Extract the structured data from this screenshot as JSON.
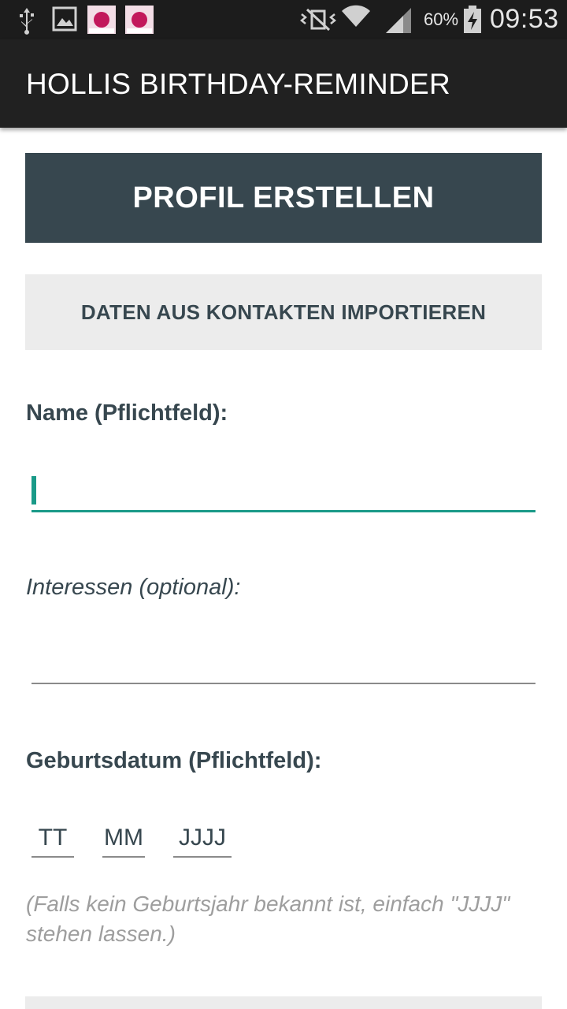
{
  "status_bar": {
    "icons": [
      "usb-icon",
      "image-icon",
      "hollis-reminder-app-icon",
      "hollis-reminder-app-icon",
      "vibrate-icon",
      "wifi-icon",
      "signal-icon",
      "battery-charging-icon"
    ],
    "battery_percent": "60%",
    "time": "09:53"
  },
  "app_bar": {
    "title": "HOLLIS BIRTHDAY-REMINDER"
  },
  "header": {
    "title": "PROFIL ERSTELLEN"
  },
  "import_button": {
    "label": "DATEN AUS KONTAKTEN IMPORTIEREN"
  },
  "form": {
    "name_label": "Name (Pflichtfeld):",
    "name_value": "",
    "interests_label": "Interessen (optional):",
    "interests_value": "",
    "birthdate_label": "Geburtsdatum (Pflichtfeld):",
    "day_placeholder": "TT",
    "month_placeholder": "MM",
    "year_placeholder": "JJJJ",
    "hint": "(Falls kein Geburtsjahr bekannt ist, einfach \"JJJJ\" stehen lassen.)"
  },
  "colors": {
    "status_bar": "#1c1c1c",
    "app_bar": "#212121",
    "header": "#37474f",
    "accent": "#1a9a88",
    "button_bg": "#ececec",
    "hint": "#9e9e9e"
  }
}
